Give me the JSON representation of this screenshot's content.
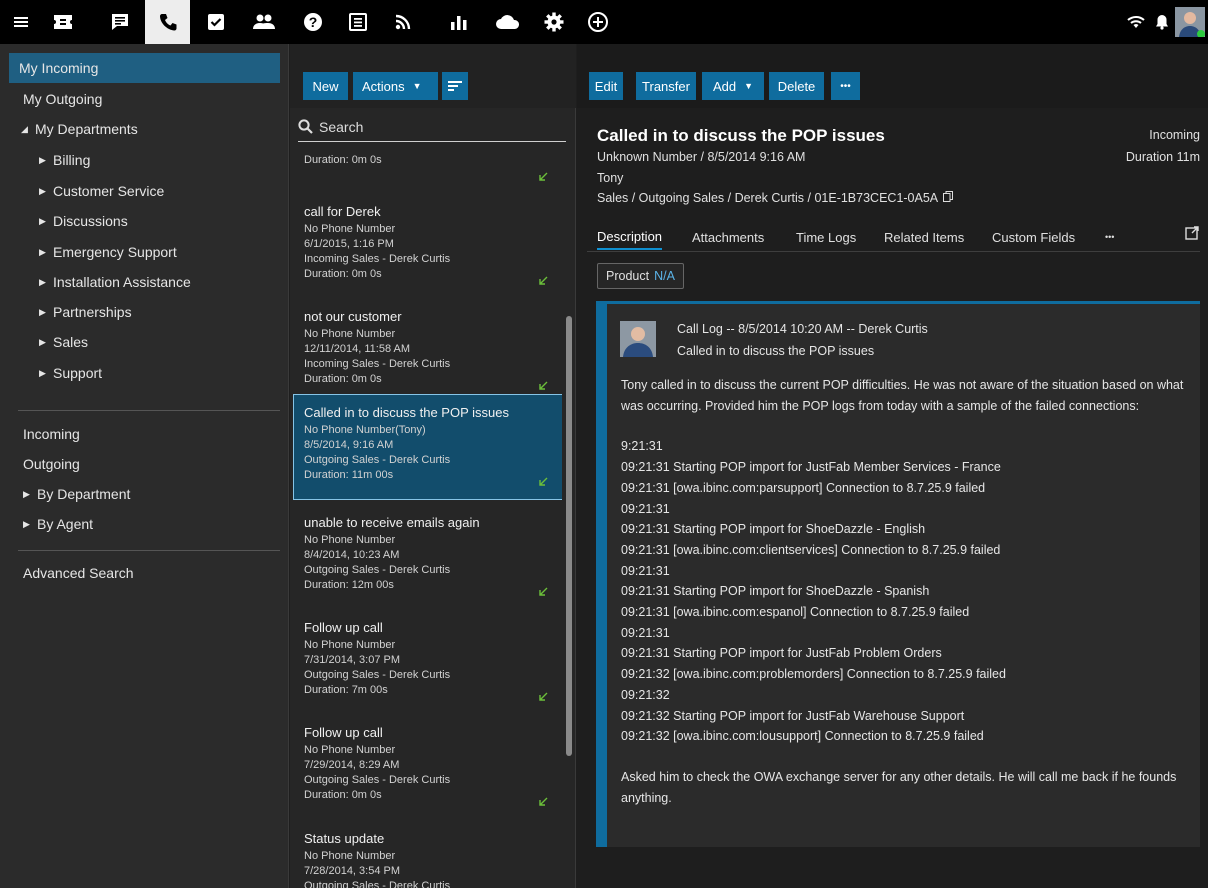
{
  "topbar": {
    "icons": [
      {
        "name": "hamburger-menu-icon",
        "active": false
      },
      {
        "name": "ticket-icon",
        "active": false
      },
      {
        "name": "chat-icon",
        "active": false
      },
      {
        "name": "phone-icon",
        "active": true
      },
      {
        "name": "task-checkbox-icon",
        "active": false
      },
      {
        "name": "contacts-icon",
        "active": false
      },
      {
        "name": "help-icon",
        "active": false
      },
      {
        "name": "knowledge-base-icon",
        "active": false
      },
      {
        "name": "rss-icon",
        "active": false
      },
      {
        "name": "reports-chart-icon",
        "active": false
      },
      {
        "name": "cloud-icon",
        "active": false
      },
      {
        "name": "settings-gear-icon",
        "active": false
      },
      {
        "name": "add-circle-icon",
        "active": false
      }
    ],
    "right_icons": [
      "wifi-icon",
      "notification-bell-icon",
      "user-avatar"
    ],
    "status_color": "#2ecc40"
  },
  "sidebar": {
    "items": [
      {
        "label": "My Incoming",
        "selected": true,
        "indent": 0
      },
      {
        "label": "My Outgoing",
        "indent": 0
      },
      {
        "label": "My Departments",
        "indent": 0,
        "expanded": true
      },
      {
        "label": "Billing",
        "indent": 1
      },
      {
        "label": "Customer Service",
        "indent": 1
      },
      {
        "label": "Discussions",
        "indent": 1
      },
      {
        "label": "Emergency Support",
        "indent": 1
      },
      {
        "label": "Installation Assistance",
        "indent": 1
      },
      {
        "label": "Partnerships",
        "indent": 1
      },
      {
        "label": "Sales",
        "indent": 1
      },
      {
        "label": "Support",
        "indent": 1
      }
    ],
    "group2": [
      {
        "label": "Incoming"
      },
      {
        "label": "Outgoing"
      },
      {
        "label": "By Department",
        "collapsed": true
      },
      {
        "label": "By Agent",
        "collapsed": true
      }
    ],
    "advanced_search": "Advanced Search"
  },
  "list": {
    "new_label": "New",
    "actions_label": "Actions",
    "search_placeholder": "Search",
    "items": [
      {
        "title": "",
        "phone": "",
        "date": "",
        "dept": "",
        "duration": "Duration: 0m 0s",
        "partial": true
      },
      {
        "title": "call for Derek",
        "phone": "No Phone Number",
        "date": "6/1/2015, 1:16 PM",
        "dept": "Incoming Sales - Derek Curtis",
        "duration": "Duration: 0m 0s"
      },
      {
        "title": "not our customer",
        "phone": "No Phone Number",
        "date": "12/11/2014, 11:58 AM",
        "dept": "Incoming Sales - Derek Curtis",
        "duration": "Duration: 0m 0s"
      },
      {
        "title": "Called in to discuss the POP issues",
        "phone": "No Phone Number(Tony)",
        "date": "8/5/2014, 9:16 AM",
        "dept": "Outgoing Sales - Derek Curtis",
        "duration": "Duration: 11m 00s",
        "selected": true
      },
      {
        "title": "unable to receive emails again",
        "phone": "No Phone Number",
        "date": "8/4/2014, 10:23 AM",
        "dept": "Outgoing Sales - Derek Curtis",
        "duration": "Duration: 12m 00s"
      },
      {
        "title": "Follow up call",
        "phone": "No Phone Number",
        "date": "7/31/2014, 3:07 PM",
        "dept": "Outgoing Sales - Derek Curtis",
        "duration": "Duration: 7m 00s"
      },
      {
        "title": "Follow up call",
        "phone": "No Phone Number",
        "date": "7/29/2014, 8:29 AM",
        "dept": "Outgoing Sales - Derek Curtis",
        "duration": "Duration: 0m 0s"
      },
      {
        "title": "Status update",
        "phone": "No Phone Number",
        "date": "7/28/2014, 3:54 PM",
        "dept": "Outgoing Sales - Derek Curtis",
        "duration": ""
      }
    ],
    "check_color": "#6cbf3a"
  },
  "detail": {
    "toolbar": {
      "edit": "Edit",
      "transfer": "Transfer",
      "add": "Add",
      "delete": "Delete",
      "more": "•••"
    },
    "title": "Called in to discuss the POP issues",
    "line1": "Unknown Number / 8/5/2014 9:16 AM",
    "line2": "Tony",
    "line3": "Sales / Outgoing Sales / Derek Curtis / 01E-1B73CEC1-0A5A",
    "direction": "Incoming",
    "duration": "Duration 11m",
    "tabs": [
      "Description",
      "Attachments",
      "Time Logs",
      "Related Items",
      "Custom Fields",
      "•••"
    ],
    "product_label": "Product",
    "product_value": "N/A",
    "log_header": "Call Log -- 8/5/2014 10:20 AM -- Derek Curtis",
    "log_sub": "Called in to discuss the POP issues",
    "log_paragraph1": "Tony called in to discuss the current POP difficulties. He was not aware of the situation based on what was occurring. Provided him the POP logs from today with a sample of the failed connections:",
    "log_lines": [
      "9:21:31",
      "09:21:31 Starting POP import for JustFab Member Services - France",
      "09:21:31 [owa.ibinc.com:parsupport] Connection to 8.7.25.9 failed",
      "09:21:31",
      "09:21:31 Starting POP import for ShoeDazzle - English",
      "09:21:31 [owa.ibinc.com:clientservices] Connection to 8.7.25.9 failed",
      "09:21:31",
      "09:21:31 Starting POP import for ShoeDazzle - Spanish",
      "09:21:31 [owa.ibinc.com:espanol] Connection to 8.7.25.9 failed",
      "09:21:31",
      "09:21:31 Starting POP import for JustFab Problem Orders",
      "09:21:32 [owa.ibinc.com:problemorders] Connection to 8.7.25.9 failed",
      "09:21:32",
      "09:21:32 Starting POP import for JustFab Warehouse Support",
      "09:21:32 [owa.ibinc.com:lousupport] Connection to 8.7.25.9 failed"
    ],
    "log_paragraph2": "Asked him to check the OWA exchange server for any other details. He will call me back if he founds anything.",
    "accent_color": "#0f6c9e"
  }
}
